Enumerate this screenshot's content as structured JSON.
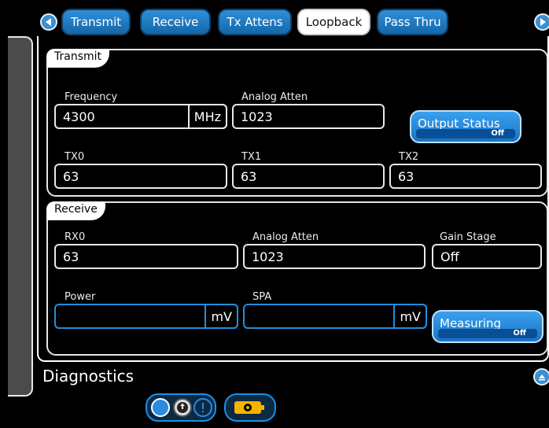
{
  "tabs": [
    {
      "label": "Transmit",
      "active": false
    },
    {
      "label": "Receive",
      "active": false
    },
    {
      "label": "Tx Attens",
      "active": false
    },
    {
      "label": "Loopback",
      "active": true
    },
    {
      "label": "Pass Thru",
      "active": false
    }
  ],
  "transmit": {
    "section_label": "Transmit",
    "frequency": {
      "label": "Frequency",
      "value": "4300",
      "unit": "MHz"
    },
    "analog_atten": {
      "label": "Analog Atten",
      "value": "1023"
    },
    "output_status": {
      "label": "Output Status",
      "state": "Off"
    },
    "tx0": {
      "label": "TX0",
      "value": "63"
    },
    "tx1": {
      "label": "TX1",
      "value": "63"
    },
    "tx2": {
      "label": "TX2",
      "value": "63"
    }
  },
  "receive": {
    "section_label": "Receive",
    "rx0": {
      "label": "RX0",
      "value": "63"
    },
    "analog_atten": {
      "label": "Analog Atten",
      "value": "1023"
    },
    "gain_stage": {
      "label": "Gain Stage",
      "value": "Off"
    },
    "power": {
      "label": "Power",
      "value": "",
      "unit": "mV"
    },
    "spa": {
      "label": "SPA",
      "value": "",
      "unit": "mV"
    },
    "measuring": {
      "label": "Measuring",
      "state": "Off"
    }
  },
  "diagnostics": {
    "title": "Diagnostics"
  },
  "colors": {
    "accent": "#1f8fe0",
    "tab_blue": "#2f8fd9",
    "panel_gray": "#4b4b4b"
  }
}
